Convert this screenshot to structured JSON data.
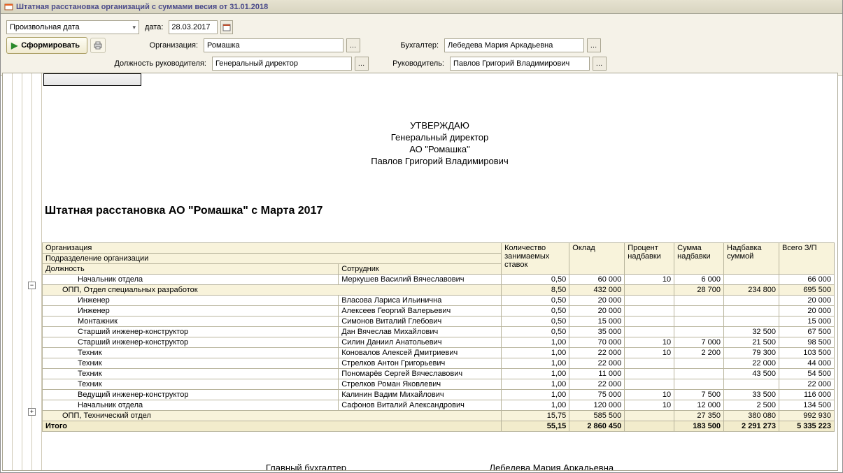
{
  "window_title": "Штатная расстановка организаций с суммами весия от 31.01.2018",
  "toolbar": {
    "date_mode": "Произвольная дата",
    "date_label": "дата:",
    "date_value": "28.03.2017",
    "form_button": "Сформировать",
    "org_label": "Организация:",
    "org_value": "Ромашка",
    "acc_label": "Бухгалтер:",
    "acc_value": "Лебедева Мария Аркадьевна",
    "pos_label": "Должность руководителя:",
    "pos_value": "Генеральный директор",
    "head_label": "Руководитель:",
    "head_value": "Павлов Григорий Владимирович"
  },
  "approval": {
    "l1": "УТВЕРЖДАЮ",
    "l2": "Генеральный директор",
    "l3": "АО \"Ромашка\"",
    "l4": "Павлов Григорий Владимирович"
  },
  "report_title": "Штатная расстановка АО \"Ромашка\" с Марта 2017",
  "columns": {
    "org": "Организация",
    "dept": "Подразделение организации",
    "pos": "Должность",
    "emp": "Сотрудник",
    "rates": "Количество занимаемых ставок",
    "salary": "Оклад",
    "pct": "Процент надбавки",
    "sum": "Сумма надбавки",
    "bonus": "Надбавка суммой",
    "total": "Всего З/П"
  },
  "rows": [
    {
      "type": "pos",
      "pos": "Начальник отдела",
      "emp": "Меркушев Василий Вячеславович",
      "rates": "0,50",
      "salary": "60 000",
      "pct": "10",
      "sum": "6 000",
      "bonus": "",
      "total": "66 000"
    },
    {
      "type": "dept",
      "pos": "ОПП, Отдел специальных разработок",
      "rates": "8,50",
      "salary": "432 000",
      "pct": "",
      "sum": "28 700",
      "bonus": "234 800",
      "total": "695 500"
    },
    {
      "type": "pos",
      "pos": "Инженер",
      "emp": "Власова Лариса Ильинична",
      "rates": "0,50",
      "salary": "20 000",
      "pct": "",
      "sum": "",
      "bonus": "",
      "total": "20 000"
    },
    {
      "type": "pos",
      "pos": "Инженер",
      "emp": "Алексеев Георгий Валерьевич",
      "rates": "0,50",
      "salary": "20 000",
      "pct": "",
      "sum": "",
      "bonus": "",
      "total": "20 000"
    },
    {
      "type": "pos",
      "pos": "Монтажник",
      "emp": "Симонов Виталий Глебович",
      "rates": "0,50",
      "salary": "15 000",
      "pct": "",
      "sum": "",
      "bonus": "",
      "total": "15 000"
    },
    {
      "type": "pos",
      "pos": "Старший инженер-конструктор",
      "emp": "Дан Вячеслав Михайлович",
      "rates": "0,50",
      "salary": "35 000",
      "pct": "",
      "sum": "",
      "bonus": "32 500",
      "total": "67 500"
    },
    {
      "type": "pos",
      "pos": "Старший инженер-конструктор",
      "emp": "Силин Даниил Анатольевич",
      "rates": "1,00",
      "salary": "70 000",
      "pct": "10",
      "sum": "7 000",
      "bonus": "21 500",
      "total": "98 500"
    },
    {
      "type": "pos",
      "pos": "Техник",
      "emp": "Коновалов Алексей Дмитриевич",
      "rates": "1,00",
      "salary": "22 000",
      "pct": "10",
      "sum": "2 200",
      "bonus": "79 300",
      "total": "103 500"
    },
    {
      "type": "pos",
      "pos": "Техник",
      "emp": "Стрелков Антон Григорьевич",
      "rates": "1,00",
      "salary": "22 000",
      "pct": "",
      "sum": "",
      "bonus": "22 000",
      "total": "44 000"
    },
    {
      "type": "pos",
      "pos": "Техник",
      "emp": "Пономарёв Сергей Вячеславович",
      "rates": "1,00",
      "salary": "11 000",
      "pct": "",
      "sum": "",
      "bonus": "43 500",
      "total": "54 500"
    },
    {
      "type": "pos",
      "pos": "Техник",
      "emp": "Стрелков Роман Яковлевич",
      "rates": "1,00",
      "salary": "22 000",
      "pct": "",
      "sum": "",
      "bonus": "",
      "total": "22 000"
    },
    {
      "type": "pos",
      "pos": "Ведущий инженер-конструктор",
      "emp": "Калинин Вадим Михайлович",
      "rates": "1,00",
      "salary": "75 000",
      "pct": "10",
      "sum": "7 500",
      "bonus": "33 500",
      "total": "116 000"
    },
    {
      "type": "pos",
      "pos": "Начальник отдела",
      "emp": "Сафонов Виталий Александрович",
      "rates": "1,00",
      "salary": "120 000",
      "pct": "10",
      "sum": "12 000",
      "bonus": "2 500",
      "total": "134 500"
    },
    {
      "type": "dept",
      "pos": "ОПП, Технический отдел",
      "rates": "15,75",
      "salary": "585 500",
      "pct": "",
      "sum": "27 350",
      "bonus": "380 080",
      "total": "992 930"
    }
  ],
  "totals_label": "Итого",
  "totals": {
    "rates": "55,15",
    "salary": "2 860 450",
    "pct": "",
    "sum": "183 500",
    "bonus": "2 291 273",
    "total": "5 335 223"
  },
  "signature": {
    "label": "Главный бухгалтер",
    "name": "Лебедева Мария Аркадьевна"
  }
}
